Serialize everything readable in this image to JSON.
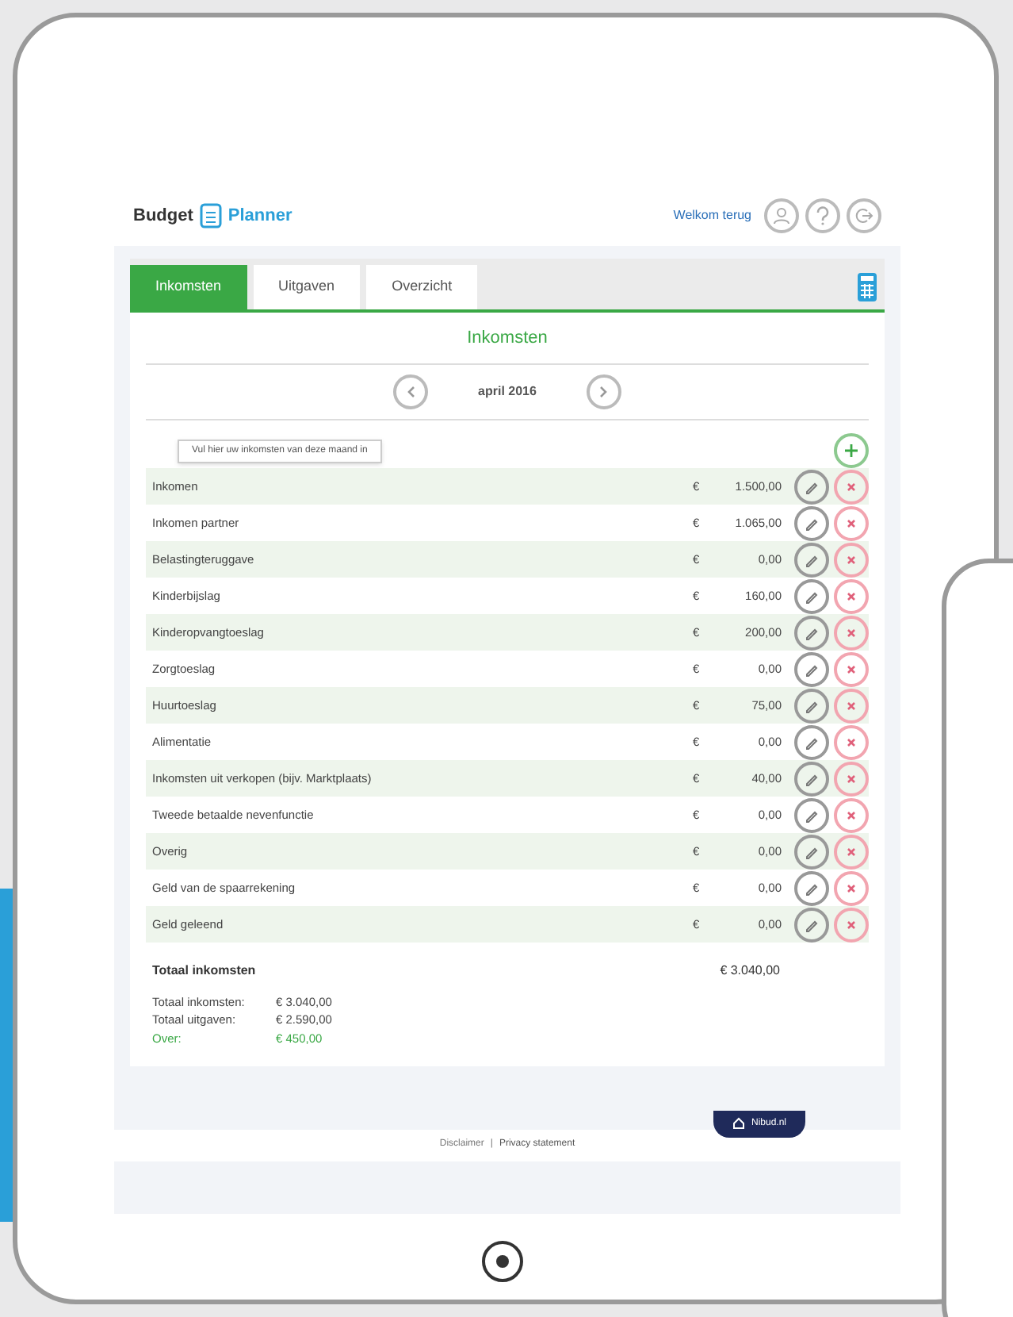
{
  "header": {
    "logo_left": "Budget",
    "logo_right": "Planner",
    "welcome": "Welkom terug"
  },
  "tabs": [
    {
      "label": "Inkomsten",
      "selected": true
    },
    {
      "label": "Uitgaven",
      "selected": false
    },
    {
      "label": "Overzicht",
      "selected": false
    }
  ],
  "section_title": "Inkomsten",
  "month": "april 2016",
  "tooltip": "Vul hier uw inkomsten van deze maand in",
  "rows": [
    {
      "label": "Inkomen",
      "currency": "€",
      "amount": "1.500,00"
    },
    {
      "label": "Inkomen partner",
      "currency": "€",
      "amount": "1.065,00"
    },
    {
      "label": "Belastingteruggave",
      "currency": "€",
      "amount": "0,00"
    },
    {
      "label": "Kinderbijslag",
      "currency": "€",
      "amount": "160,00"
    },
    {
      "label": "Kinderopvangtoeslag",
      "currency": "€",
      "amount": "200,00"
    },
    {
      "label": "Zorgtoeslag",
      "currency": "€",
      "amount": "0,00"
    },
    {
      "label": "Huurtoeslag",
      "currency": "€",
      "amount": "75,00"
    },
    {
      "label": "Alimentatie",
      "currency": "€",
      "amount": "0,00"
    },
    {
      "label": "Inkomsten uit verkopen (bijv. Marktplaats)",
      "currency": "€",
      "amount": "40,00"
    },
    {
      "label": "Tweede betaalde nevenfunctie",
      "currency": "€",
      "amount": "0,00"
    },
    {
      "label": "Overig",
      "currency": "€",
      "amount": "0,00"
    },
    {
      "label": "Geld van de spaarrekening",
      "currency": "€",
      "amount": "0,00"
    },
    {
      "label": "Geld geleend",
      "currency": "€",
      "amount": "0,00"
    }
  ],
  "total": {
    "label": "Totaal inkomsten",
    "amount": "€ 3.040,00"
  },
  "summary": [
    {
      "label": "Totaal inkomsten:",
      "amount": "€ 3.040,00",
      "kind": "plain"
    },
    {
      "label": "Totaal uitgaven:",
      "amount": "€ 2.590,00",
      "kind": "plain"
    },
    {
      "label": "Over:",
      "amount": "€ 450,00",
      "kind": "positive"
    }
  ],
  "footer": {
    "links": [
      "Disclaimer",
      "Privacy statement"
    ],
    "separator": "|",
    "badge": "Nibud.nl"
  }
}
